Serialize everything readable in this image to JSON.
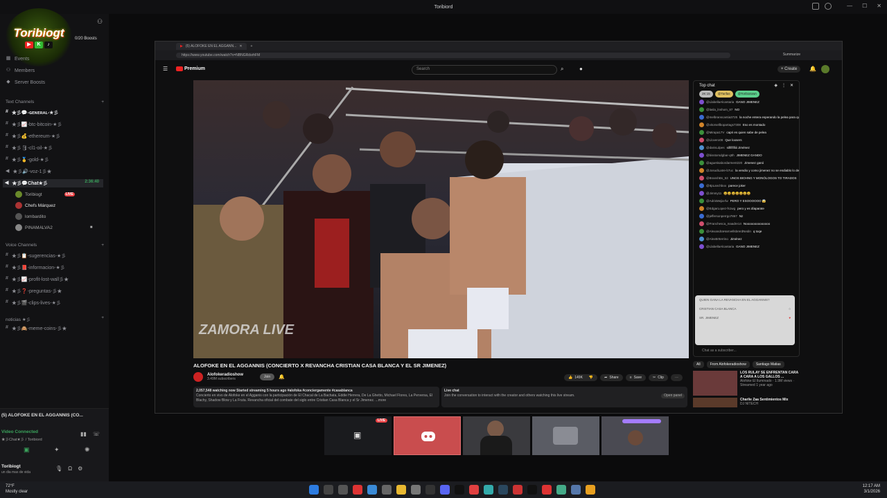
{
  "window": {
    "title": "Toribiord"
  },
  "server": {
    "logo_text": "Toribiogt",
    "boosts": "0/20 Boosts",
    "menu": [
      "Events",
      "Members",
      "Server Boosts"
    ]
  },
  "categories": {
    "text": "Text Channels",
    "voice": "Voice Channels",
    "noticias": "noticias ★彡"
  },
  "text_channels": [
    "★彡💬-ɢᴇɴᴇʀᴀʟ-★彡",
    "★彡📈-btc-bitcoin-★彡",
    "★彡💰-ethereum-★彡",
    "★彡🛢-cl1-oil-★彡",
    "★彡🥇-gold-★彡",
    "★彡🔊-voz-1彡★"
  ],
  "active_channel": {
    "name": "★彡💬Chat★彡",
    "timer": "2:36:40"
  },
  "voice_users": [
    {
      "name": "Toribiogt",
      "live": "LIVE"
    },
    {
      "name": "Chefs Márquez",
      "live": ""
    },
    {
      "name": "lombardito",
      "live": ""
    },
    {
      "name": "PINAMALVA2",
      "live": ""
    }
  ],
  "voice_channels": [
    "★彡📋-sugerencias-★彡",
    "★彡📕-informacion-★彡",
    "★彡📈-profit-lost-wall彡★",
    "★彡❓-preguntas-彡★",
    "★彡🎬-clips-lives-★彡"
  ],
  "noticias_channels": [
    "★彡🙈-meme-coins-彡★"
  ],
  "voice_panel": {
    "stream_title": "(5) ALOFOKE EN EL AGGANNIS (CO...",
    "status": "Video Connected",
    "channel_path": "★彡Chat★彡 / Toribiord",
    "username": "Toribiogt",
    "user_status": "un dia mas de vida"
  },
  "browser": {
    "tab_title": "(5) ALOFOKE EN EL AGGANN...",
    "url": "https://www.youtube.com/watch?v=NBNGRdsrhFM",
    "summarize": "Summarize"
  },
  "youtube": {
    "logo": "Premium",
    "search_placeholder": "Search",
    "create": "Create",
    "video_title": "ALOFOKE EN EL AGGANNIS (CONCIERTO X REVANCHA CRISTIAN CASA BLANCA Y EL SR JIMENEZ)",
    "channel_name": "Alofokeradioshow",
    "subscribers": "3.49M subscribers",
    "join": "Join",
    "likes": "149K",
    "share": "Share",
    "save": "Save",
    "clip": "Clip",
    "watching": "2,057,548 watching now  Started streaming 5 hours ago  #alofoka #conciergamente #casablanca",
    "description": "Concierto en vivo de Alofoke en el Agganis con la participación de El Chacal de La Bachata, Eddie Herrera, De La Ghetto, Michael Flores, La Perversa, El Blachy, Shadow Blow y La Fruta. Revancha oficial del combate del siglo entre Cristian Casa Blanca y el Sr Jimenez. ...more",
    "live_chat_label": "Live chat",
    "live_chat_prompt": "Join the conversation to interact with the creator and others watching this live stream.",
    "open_panel": "Open panel",
    "watermark": "ZAMORA LIVE"
  },
  "chat": {
    "header": "Top chat",
    "pins": [
      "2K:15",
      "@Tarifas",
      "@Toribiotown"
    ],
    "messages": [
      {
        "user": "@LlabellaAlcantaria",
        "text": "GANO JIMENEZ",
        "color": "#7d4fcf"
      },
      {
        "user": "@lasla_lnshom_87",
        "text": "NO",
        "color": "#3b8f3b"
      },
      {
        "user": "@melbranscantia3725",
        "text": "la noche entera esperando la pelea para que terminen así",
        "color": "#3a6bd1"
      },
      {
        "user": "@vitorsellbopartags7308",
        "text": "Eso es montado",
        "color": "#d1842a"
      },
      {
        "user": "@Mirapa17V",
        "text": "capri es quien sabe de pelea",
        "color": "#3b8f3b"
      },
      {
        "user": "@Llovero08",
        "text": "Que loosers",
        "color": "#cf4f6d"
      },
      {
        "user": "@darisLdpes",
        "text": "sififififiiii Jiménez",
        "color": "#4f8fcf"
      },
      {
        "user": "@bisstorsdgbar-q8h",
        "text": "JIMENEZ GANDO",
        "color": "#7d4fcf"
      },
      {
        "user": "@aguetisabordarment220",
        "text": "Jimenez ganó",
        "color": "#3b8f3b"
      },
      {
        "user": "@JosudiLatre-b7uc",
        "text": "la vendio y como jimenez no se endiablo lo dejo empate",
        "color": "#d1842a"
      },
      {
        "user": "@BranshBs_53",
        "text": "UNOS BIOHNG Y MONÓLOGOS TO TIRADOS",
        "color": "#cf4f6d"
      },
      {
        "user": "@ItpLanchbox",
        "text": "parece joker",
        "color": "#3a6bd1"
      },
      {
        "user": "@Jimmy11",
        "text": "😄😄😄😄😄😄😄",
        "color": "#7d4fcf"
      },
      {
        "user": "@AdrisMejia-fw",
        "text": "PERO Y ESOOOOOO 😱",
        "color": "#3b8f3b"
      },
      {
        "user": "@EdgarLopez-fs1wg",
        "text": "pero y es díaparate",
        "color": "#d1842a"
      },
      {
        "user": "@jeffersonperrgo7867",
        "text": "Nz",
        "color": "#3a6bd1"
      },
      {
        "user": "@Franchesca_maadre14",
        "text": "Noooooooooooooo",
        "color": "#cf4f6d"
      },
      {
        "user": "@AlexandraHarrvellsbrerdNedin",
        "text": "q toqe",
        "color": "#3b8f3b"
      },
      {
        "user": "@AlexBrtterrino",
        "text": "Jiménez",
        "color": "#4f8fcf"
      },
      {
        "user": "@LlabellaAlcantaria",
        "text": "GANO JIMENEZ",
        "color": "#7d4fcf"
      }
    ],
    "poll_question": "QUIEN GANA LA REVANCHA EN EL AGGANNIS?",
    "poll_options": [
      "CRISTIAN CASA BLANCA",
      "SR. JIMENEZ"
    ],
    "input_placeholder": "Chat as a subscriber..."
  },
  "recommendations": {
    "chips": [
      "All",
      "From Alofokeradioshow",
      "Santiago Matias"
    ],
    "items": [
      {
        "title": "LOS RULAY SE ENFRENTAN CARA A CARA A LOS GALLOS ...",
        "meta": "Alofoke El Iluminado · 1.9M views · Streamed 1 year ago"
      },
      {
        "title": "Charlie Zaa Sentimientos Mix",
        "meta": "DJ NITECH"
      }
    ]
  },
  "stream_tiles": {
    "live": "LIVE"
  },
  "taskbar": {
    "temp": "72°F",
    "weather": "Mostly clear",
    "time": "12:17 AM",
    "date": "3/1/2026"
  }
}
